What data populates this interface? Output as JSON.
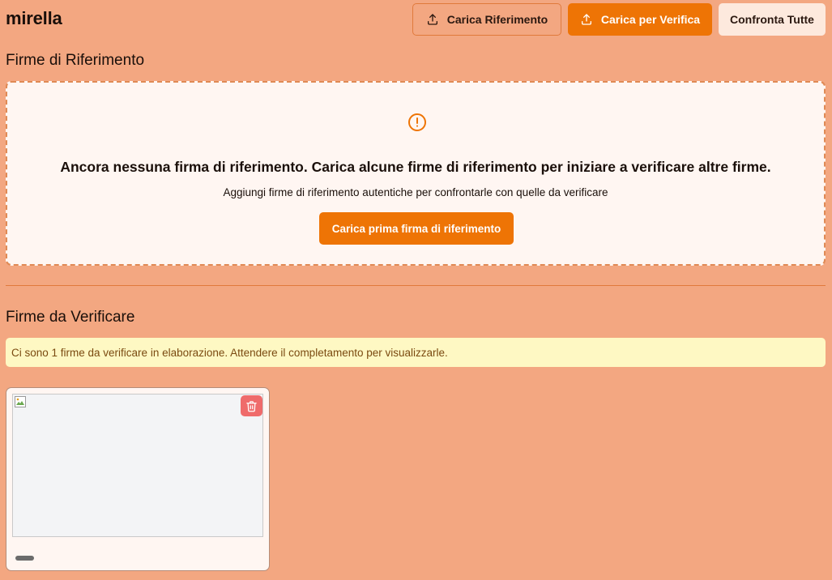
{
  "header": {
    "title": "mirella",
    "buttons": {
      "upload_reference": "Carica Riferimento",
      "upload_verify": "Carica per Verifica",
      "compare_all": "Confronta Tutte"
    }
  },
  "reference_section": {
    "title": "Firme di Riferimento",
    "empty_title": "Ancora nessuna firma di riferimento. Carica alcune firme di riferimento per iniziare a verificare altre firme.",
    "empty_subtitle": "Aggiungi firme di riferimento autentiche per confrontarle con quelle da verificare",
    "first_upload_button": "Carica prima firma di riferimento",
    "icon": "alert-circle-icon"
  },
  "verify_section": {
    "title": "Firme da Verificare",
    "notice": "Ci sono 1 firme da verificare in elaborazione. Attendere il completamento per visualizzarle.",
    "cards": [
      {
        "image_icon": "broken-image-icon",
        "delete_icon": "trash-icon"
      }
    ]
  },
  "colors": {
    "background": "#f3a781",
    "accent": "#ee7405",
    "panel": "#fff6f2",
    "notice_bg": "#fef8c3",
    "danger": "#ef6b6b"
  }
}
